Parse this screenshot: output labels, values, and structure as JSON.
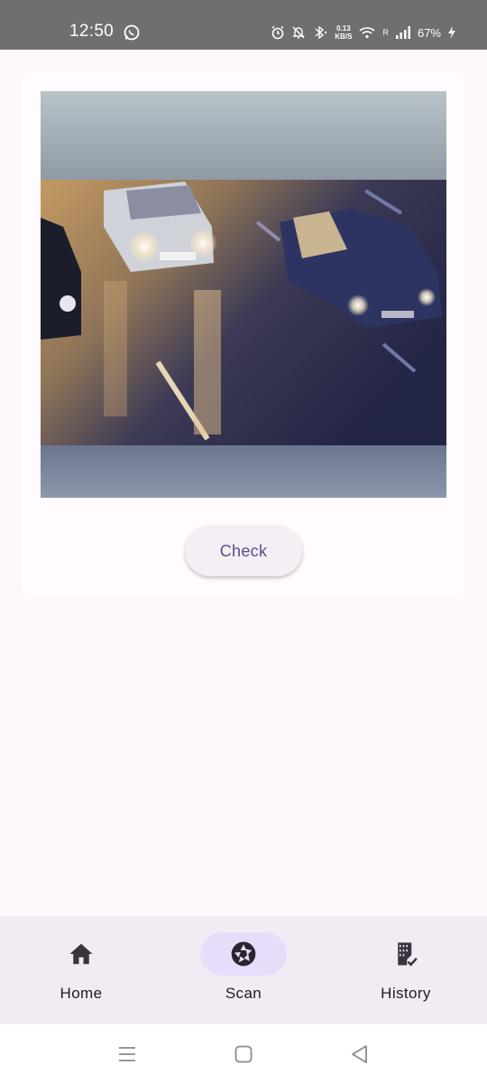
{
  "status_bar": {
    "time": "12:50",
    "net_speed_value": "0.13",
    "net_speed_unit": "KB/S",
    "roaming": "R",
    "battery": "67%",
    "icons": [
      "whatsapp-icon",
      "alarm-icon",
      "mute-icon",
      "bluetooth-icon",
      "wifi-icon",
      "signal-icon",
      "charging-icon"
    ]
  },
  "card": {
    "preview_icon": "camera-preview-image",
    "check_label": "Check"
  },
  "bottom_nav": {
    "items": [
      {
        "label": "Home",
        "icon": "home-icon",
        "active": false
      },
      {
        "label": "Scan",
        "icon": "camera-shutter-icon",
        "active": true
      },
      {
        "label": "History",
        "icon": "history-icon",
        "active": false
      }
    ]
  },
  "system_nav": {
    "items": [
      "recents-icon",
      "home-square-icon",
      "back-icon"
    ]
  },
  "colors": {
    "status_bar": "#6f6f6f",
    "background": "#fdf8fc",
    "accent": "#5b4a92",
    "nav_bg": "#f1ecf3",
    "active_pill": "#e7ddfb"
  }
}
